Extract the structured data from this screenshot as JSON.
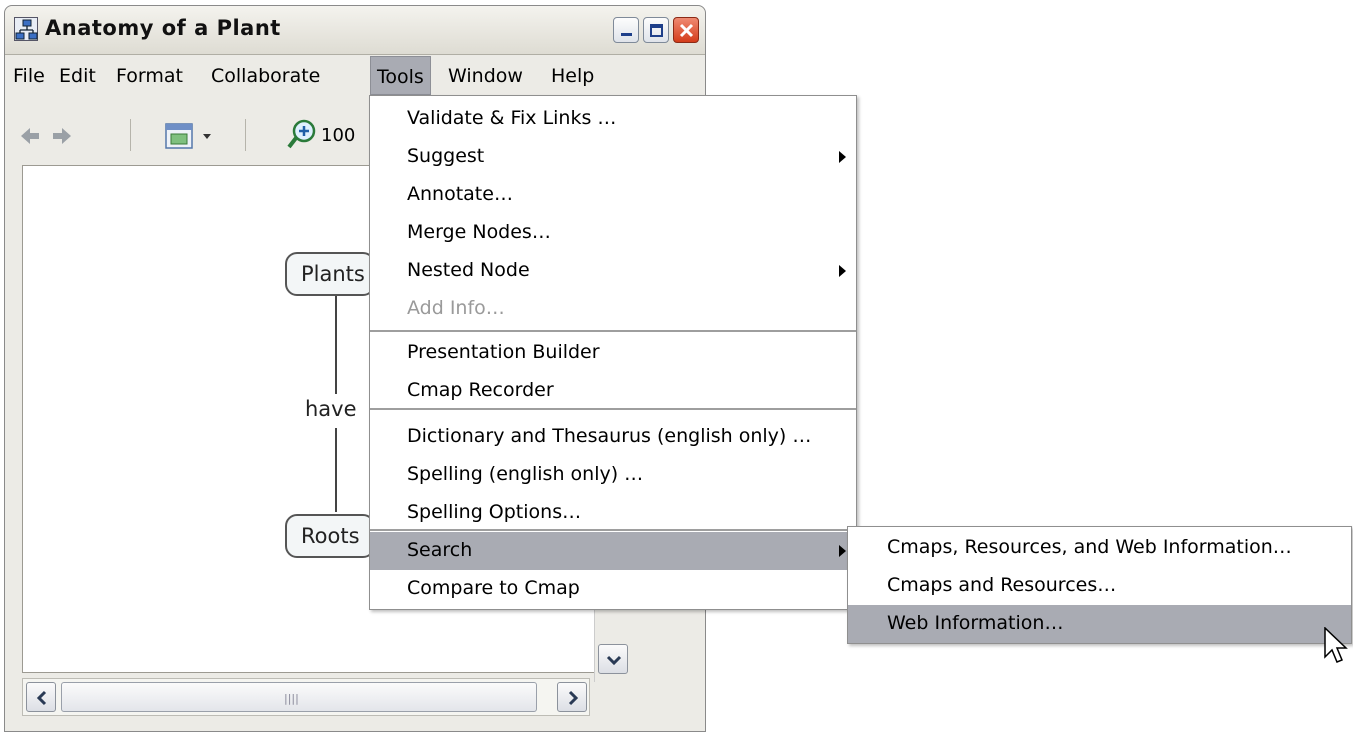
{
  "window": {
    "title": "Anatomy of a Plant",
    "minimize_icon": "minimize-icon",
    "maximize_icon": "maximize-icon",
    "close_icon": "close-icon"
  },
  "menubar": {
    "items": [
      "File",
      "Edit",
      "Format",
      "Collaborate",
      "Tools",
      "Window",
      "Help"
    ],
    "active": "Tools"
  },
  "toolbar": {
    "zoom_value": "100",
    "icons": [
      "back-arrow-icon",
      "forward-arrow-icon",
      "view-options-icon",
      "zoom-in-icon"
    ]
  },
  "canvas": {
    "nodes": [
      "Plants",
      "Roots"
    ],
    "link_label": "have"
  },
  "tools_menu": {
    "groups": [
      [
        {
          "label": "Validate & Fix Links …",
          "submenu": false,
          "disabled": false
        },
        {
          "label": "Suggest",
          "submenu": true,
          "disabled": false
        },
        {
          "label": "Annotate…",
          "submenu": false,
          "disabled": false
        },
        {
          "label": "Merge Nodes…",
          "submenu": false,
          "disabled": false
        },
        {
          "label": "Nested Node",
          "submenu": true,
          "disabled": false
        },
        {
          "label": "Add Info…",
          "submenu": false,
          "disabled": true
        }
      ],
      [
        {
          "label": "Presentation Builder",
          "submenu": false,
          "disabled": false
        },
        {
          "label": "Cmap Recorder",
          "submenu": false,
          "disabled": false
        }
      ],
      [
        {
          "label": "Dictionary and Thesaurus (english only) …",
          "submenu": false,
          "disabled": false
        },
        {
          "label": "Spelling (english only) …",
          "submenu": false,
          "disabled": false
        },
        {
          "label": "Spelling Options…",
          "submenu": false,
          "disabled": false
        }
      ],
      [
        {
          "label": "Search",
          "submenu": true,
          "disabled": false,
          "highlighted": true
        },
        {
          "label": "Compare to Cmap",
          "submenu": false,
          "disabled": false
        }
      ]
    ]
  },
  "search_submenu": {
    "items": [
      {
        "label": "Cmaps, Resources, and Web Information…",
        "highlighted": false
      },
      {
        "label": "Cmaps and Resources…",
        "highlighted": false
      },
      {
        "label": "Web Information…",
        "highlighted": true
      }
    ]
  },
  "colors": {
    "highlight": "#a9abb3",
    "window_chrome": "#ecebe6",
    "close_button": "#d43c1a"
  }
}
